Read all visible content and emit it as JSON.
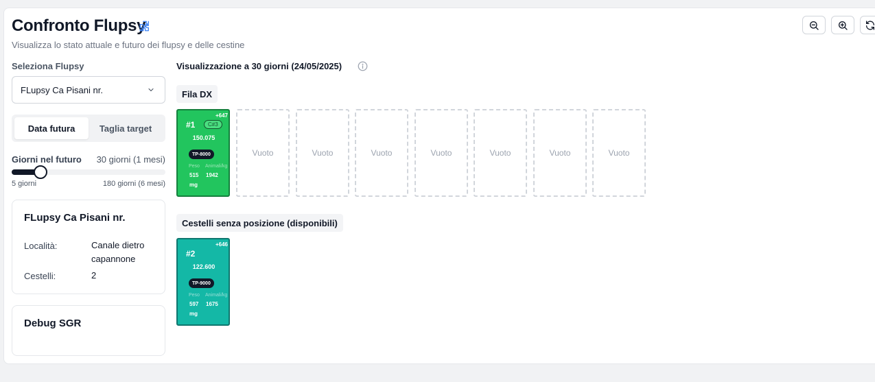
{
  "header": {
    "title": "Confronto Flupsy",
    "subtitle": "Visualizza lo stato attuale e futuro dei flupsy e delle cestine"
  },
  "toolbar": {
    "buttons": [
      "zoom-out-icon",
      "zoom-in-icon",
      "refresh-icon"
    ]
  },
  "sidebar": {
    "select_label": "Seleziona Flupsy",
    "selected_flupsy": "FLupsy Ca Pisani nr.",
    "tabs": [
      {
        "label": "Data futura",
        "active": true
      },
      {
        "label": "Taglia target",
        "active": false
      }
    ],
    "slider": {
      "label": "Giorni nel futuro",
      "value_text": "30 giorni (1 mesi)",
      "value": 30,
      "min": 5,
      "max": 180,
      "min_label": "5 giorni",
      "max_label": "180 giorni (6 mesi)"
    },
    "info_card": {
      "title": "FLupsy Ca Pisani nr.",
      "location_key": "Località:",
      "location_val": "Canale dietro capannone",
      "baskets_key": "Cestelli:",
      "baskets_val": "2"
    },
    "debug_card": {
      "title": "Debug SGR"
    }
  },
  "main": {
    "viz_title": "Visualizzazione a 30 giorni (24/05/2025)",
    "row_dx": {
      "label": "Fila DX",
      "basket": {
        "number": "#1",
        "delta": "+647",
        "cycle": "C#3",
        "count": "150.075",
        "tp": "TP-8000",
        "weight_label": "Peso",
        "weight_value": "515",
        "weight_unit": "mg",
        "animals_label": "Animali/kg",
        "animals_value": "1942"
      },
      "empty_label": "Vuoto",
      "empty_slots": 7
    },
    "unpositioned": {
      "label": "Cestelli senza posizione (disponibili)",
      "basket": {
        "number": "#2",
        "delta": "+646",
        "count": "122.600",
        "tp": "TP-9000",
        "weight_label": "Peso",
        "weight_value": "597",
        "weight_unit": "mg",
        "animals_label": "Animali/kg",
        "animals_value": "1675"
      }
    }
  },
  "colors": {
    "basket_green": "#22c55e",
    "basket_teal": "#14b8a6",
    "accent_blue": "#3b82f6"
  }
}
